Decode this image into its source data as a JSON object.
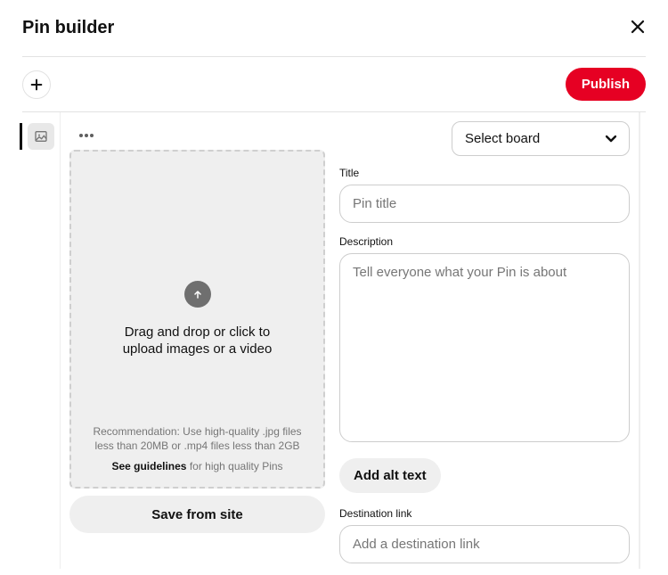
{
  "header": {
    "title": "Pin builder"
  },
  "toolbar": {
    "publish_label": "Publish"
  },
  "board_select": {
    "placeholder": "Select board"
  },
  "upload": {
    "main_text": "Drag and drop or click to upload images or a video",
    "recommendation": "Recommendation: Use high-quality .jpg files less than 20MB or .mp4 files less than 2GB",
    "guidelines_strong": "See guidelines",
    "guidelines_rest": " for high quality Pins"
  },
  "buttons": {
    "save_from_site": "Save from site",
    "add_alt_text": "Add alt text"
  },
  "fields": {
    "title_label": "Title",
    "title_placeholder": "Pin title",
    "description_label": "Description",
    "description_placeholder": "Tell everyone what your Pin is about",
    "destination_label": "Destination link",
    "destination_placeholder": "Add a destination link"
  }
}
